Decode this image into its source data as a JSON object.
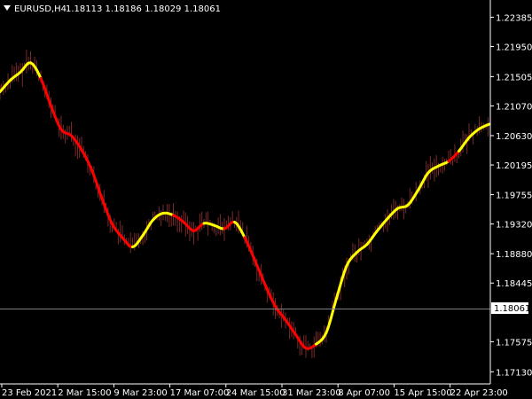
{
  "header": {
    "menu_icon": "triangle-down-icon",
    "symbol": "EURUSD,H4",
    "ohlc": "1.18113 1.18186 1.18029 1.18061"
  },
  "current_price_label": "1.18061",
  "colors": {
    "background": "#000000",
    "axis": "#ffffff",
    "candles": "#7a2a2a",
    "indicator_up": "#ffff00",
    "indicator_down": "#ff0000",
    "price_line": "#808080",
    "price_tag_bg": "#ffffff"
  },
  "chart_data": {
    "type": "line",
    "title": "",
    "xlabel": "",
    "ylabel": "",
    "ylim": [
      1.1695,
      1.2264
    ],
    "current_price": 1.18061,
    "y_ticks": [
      "1.22385",
      "1.21950",
      "1.21505",
      "1.21070",
      "1.20630",
      "1.20195",
      "1.19755",
      "1.19320",
      "1.18880",
      "1.18445",
      "1.17575",
      "1.17130"
    ],
    "x_ticks": [
      "23 Feb 2021",
      "2 Mar 15:00",
      "9 Mar 23:00",
      "17 Mar 07:00",
      "24 Mar 15:00",
      "31 Mar 23:00",
      "8 Apr 07:00",
      "15 Apr 15:00",
      "22 Apr 23:00"
    ],
    "series": [
      {
        "values": [
          1.2128,
          1.2145,
          1.2157,
          1.2171,
          1.2148,
          1.2107,
          1.2072,
          1.2063,
          1.2042,
          1.2012,
          1.197,
          1.1932,
          1.1912,
          1.1898,
          1.1915,
          1.1938,
          1.1948,
          1.1945,
          1.1935,
          1.1922,
          1.1933,
          1.193,
          1.1925,
          1.1935,
          1.1912,
          1.1878,
          1.1842,
          1.181,
          1.179,
          1.1768,
          1.1748,
          1.1754,
          1.1771,
          1.1822,
          1.187,
          1.189,
          1.1902,
          1.1922,
          1.194,
          1.1955,
          1.196,
          1.1982,
          1.2008,
          1.2018,
          1.2025,
          1.204,
          1.206,
          1.2073,
          1.208
        ],
        "direction": [
          "up",
          "up",
          "up",
          "up",
          "down",
          "down",
          "down",
          "down",
          "down",
          "down",
          "down",
          "down",
          "down",
          "up",
          "up",
          "up",
          "up",
          "down",
          "down",
          "down",
          "up",
          "up",
          "down",
          "up",
          "down",
          "down",
          "down",
          "down",
          "down",
          "down",
          "down",
          "up",
          "up",
          "up",
          "up",
          "up",
          "up",
          "up",
          "up",
          "up",
          "up",
          "up",
          "up",
          "up",
          "down",
          "up",
          "up",
          "up",
          "up"
        ]
      }
    ],
    "grid": false,
    "legend": "none"
  }
}
